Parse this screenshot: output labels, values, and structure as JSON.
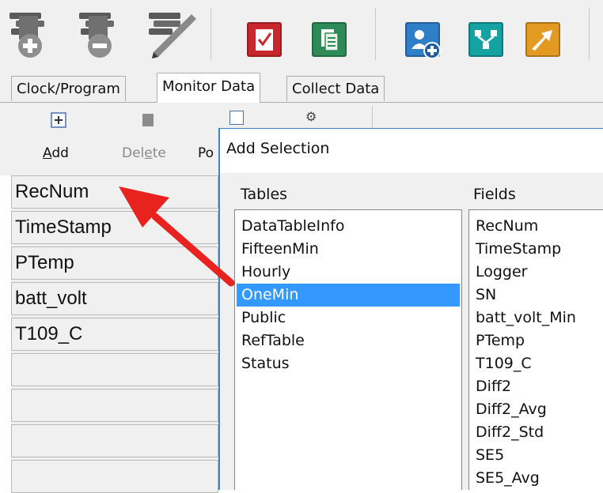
{
  "toolbar": {
    "buttons": [
      {
        "icon": "add-station-icon"
      },
      {
        "icon": "delete-station-icon"
      },
      {
        "icon": "edit-station-icon"
      },
      {
        "icon": "checklist-icon",
        "color": "#c8282d"
      },
      {
        "icon": "copy-document-icon",
        "color": "#2e8b57"
      },
      {
        "icon": "search-station-icon",
        "color": "#2f7fc8"
      },
      {
        "icon": "network-icon",
        "color": "#17a2a2"
      },
      {
        "icon": "connect-icon",
        "color": "#e39a23"
      }
    ]
  },
  "tabs": [
    {
      "label": "Clock/Program",
      "active": false
    },
    {
      "label": "Monitor Data",
      "active": true
    },
    {
      "label": "Collect Data",
      "active": false
    }
  ],
  "subtoolbar": {
    "add": {
      "pre": "",
      "u": "A",
      "post": "dd"
    },
    "delete": {
      "pre": "Del",
      "u": "e",
      "post": "te"
    },
    "partial_label": "Po"
  },
  "monitor_fields": [
    "RecNum",
    "TimeStamp",
    "PTemp",
    "batt_volt",
    "T109_C",
    "",
    "",
    "",
    ""
  ],
  "dialog": {
    "title": "Add Selection",
    "tables_label": "Tables",
    "fields_label": "Fields",
    "tables": [
      "DataTableInfo",
      "FifteenMin",
      "Hourly",
      "OneMin",
      "Public",
      "RefTable",
      "Status"
    ],
    "selected_table": "OneMin",
    "fields": [
      "RecNum",
      "TimeStamp",
      "Logger",
      "SN",
      "batt_volt_Min",
      "PTemp",
      "T109_C",
      "Diff2",
      "Diff2_Avg",
      "Diff2_Std",
      "SE5",
      "SE5_Avg"
    ]
  },
  "colors": {
    "selection": "#3399ff",
    "arrow": "#e8231f",
    "dialog_border": "#3a85c7"
  }
}
